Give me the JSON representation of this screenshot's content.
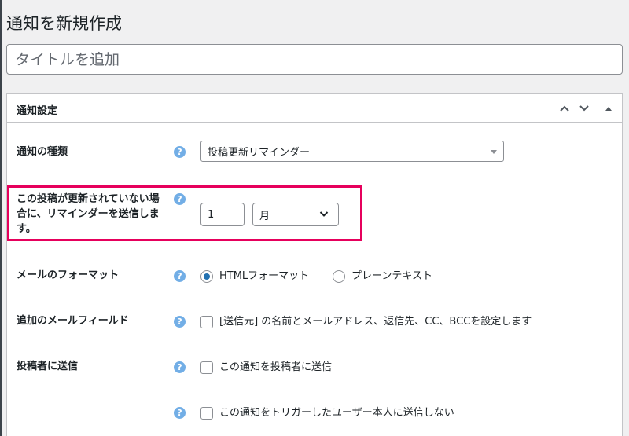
{
  "page": {
    "title": "通知を新規作成"
  },
  "title_field": {
    "placeholder": "タイトルを追加"
  },
  "metabox": {
    "title": "通知設定"
  },
  "rows": {
    "type": {
      "label": "通知の種類",
      "value": "投稿更新リマインダー"
    },
    "reminder": {
      "label_line1": "この投稿が更新されていない場",
      "label_line2": "合に、リマインダーを送信しま",
      "label_line3": "す。",
      "number": "1",
      "unit": "月"
    },
    "format": {
      "label": "メールのフォーマット",
      "option_html": "HTMLフォーマット",
      "option_plain": "プレーンテキスト",
      "selected": "html"
    },
    "extra_fields": {
      "label": "追加のメールフィールド",
      "option": "[送信元] の名前とメールアドレス、返信先、CC、BCCを設定します"
    },
    "send_author": {
      "label": "投稿者に送信",
      "option": "この通知を投稿者に送信"
    },
    "no_trigger_user": {
      "option": "この通知をトリガーしたユーザー本人に送信しない"
    }
  },
  "icons": {
    "help": "question-circle-icon",
    "up": "chevron-up-icon",
    "down": "chevron-down-icon",
    "toggle": "triangle-up-icon"
  },
  "colors": {
    "highlight": "#e6005c",
    "help": "#72aee6",
    "radio": "#2271b1"
  }
}
